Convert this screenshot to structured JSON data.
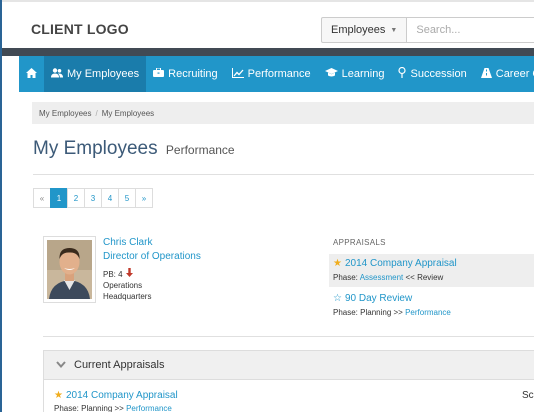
{
  "header": {
    "logo": "CLIENT LOGO",
    "search_scope": "Employees",
    "search_placeholder": "Search..."
  },
  "nav": {
    "items": [
      {
        "label": "",
        "icon": "home-icon"
      },
      {
        "label": "My Employees",
        "icon": "users-icon",
        "active": true
      },
      {
        "label": "Recruiting",
        "icon": "briefcase-icon"
      },
      {
        "label": "Performance",
        "icon": "line-chart-icon"
      },
      {
        "label": "Learning",
        "icon": "graduation-cap-icon"
      },
      {
        "label": "Succession",
        "icon": "map-pin-icon"
      },
      {
        "label": "Career Center",
        "icon": "road-icon"
      },
      {
        "label": "",
        "icon": "bar-chart-icon"
      }
    ]
  },
  "breadcrumb": {
    "items": [
      "My Employees",
      "My Employees"
    ],
    "separator": "/"
  },
  "page": {
    "title": "My Employees",
    "subtitle": "Performance"
  },
  "pagination": {
    "prev": "«",
    "pages": [
      "1",
      "2",
      "3",
      "4",
      "5"
    ],
    "next": "»",
    "current": "1"
  },
  "employee": {
    "name": "Chris Clark",
    "role": "Director of Operations",
    "pb_label": "PB: 4",
    "department": "Operations",
    "location": "Headquarters"
  },
  "appraisals": {
    "heading": "APPRAISALS",
    "items": [
      {
        "title": "2014 Company Appraisal",
        "phase_prefix": "Phase:",
        "phase_link": "Assessment",
        "phase_suffix": "<< Review",
        "star": "filled"
      },
      {
        "title": "90 Day Review",
        "phase_prefix": "Phase: Planning >>",
        "phase_link": "Performance",
        "phase_suffix": "",
        "star": "empty"
      }
    ]
  },
  "current_appraisals": {
    "heading": "Current Appraisals",
    "items": [
      {
        "title": "2014 Company Appraisal",
        "phase_prefix": "Phase: Planning >>",
        "phase_link": "Performance"
      }
    ],
    "column_label": "Sc"
  },
  "colors": {
    "brand_blue": "#2196c9",
    "nav_active": "#1a7cab",
    "dark_band": "#414a54",
    "star_gold": "#f0ad1e",
    "decline_red": "#c0392b"
  }
}
